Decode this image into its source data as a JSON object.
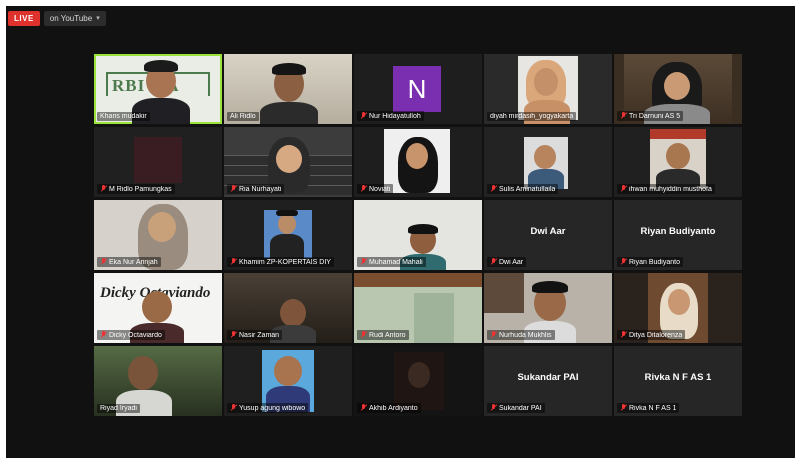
{
  "header": {
    "live_label": "LIVE",
    "youtube_label": "on YouTube",
    "youtube_chevron": "chevron-down-icon"
  },
  "participants": [
    {
      "name": "Kharis mudakir",
      "muted": false
    },
    {
      "name": "Ali Ridlo",
      "muted": false
    },
    {
      "name": "Nur Hidayatulloh",
      "muted": true,
      "avatar_letter": "N"
    },
    {
      "name": "diyah mirdasih_yogyakarta",
      "muted": false
    },
    {
      "name": "Tri Darnuni AS 5",
      "muted": true
    },
    {
      "name": "M Ridlo Pamungkas",
      "muted": true
    },
    {
      "name": "Ria Nurhayati",
      "muted": true
    },
    {
      "name": "Noviati",
      "muted": true
    },
    {
      "name": "Sulis Aminatullaila",
      "muted": true
    },
    {
      "name": "ihwan muhyiddin musthofa",
      "muted": true
    },
    {
      "name": "Eka Nur Arinjah",
      "muted": true
    },
    {
      "name": "Khamim ZP-KOPERTAIS DIY",
      "muted": true
    },
    {
      "name": "Muhamad Mahali",
      "muted": true
    },
    {
      "name": "Dwi Aar",
      "muted": true,
      "display_name": "Dwi Aar"
    },
    {
      "name": "Riyan Budiyanto",
      "muted": true,
      "display_name": "Riyan Budiyanto"
    },
    {
      "name": "Dicky Octaviardo",
      "muted": true,
      "banner_text": "Dicky Octaviando"
    },
    {
      "name": "Nasir Zaman",
      "muted": true
    },
    {
      "name": "Rudi Antoro",
      "muted": true
    },
    {
      "name": "Nurhuda Mukhlis",
      "muted": true
    },
    {
      "name": "Ditya Ditalorenza",
      "muted": true
    },
    {
      "name": "Riyad Iryadi",
      "muted": false
    },
    {
      "name": "Yusup agung wibowo",
      "muted": true
    },
    {
      "name": "Akhib Ardiyanto",
      "muted": true
    },
    {
      "name": "Sukandar PAI",
      "muted": true,
      "display_name": "Sukandar PAI"
    },
    {
      "name": "Rivka N F AS 1",
      "muted": true,
      "display_name": "Rivka N F AS 1"
    }
  ],
  "colors": {
    "live": "#e0322c",
    "active_speaker": "#9be23a",
    "avatar_purple": "#7a2fb0",
    "mute": "#e33333"
  }
}
